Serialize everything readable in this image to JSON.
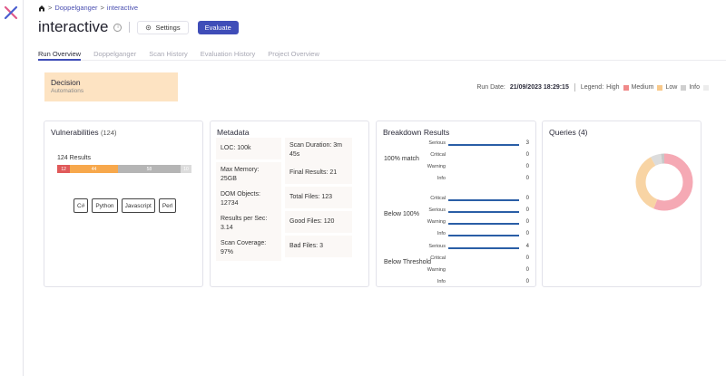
{
  "breadcrumb": {
    "items": [
      "Doppelganger",
      "interactive"
    ],
    "separator": ">"
  },
  "header": {
    "title": "interactive",
    "settings_label": "Settings",
    "evaluate_label": "Evaluate"
  },
  "tabs": [
    {
      "label": "Run Overview",
      "active": true
    },
    {
      "label": "Doppelganger",
      "active": false
    },
    {
      "label": "Scan History",
      "active": false
    },
    {
      "label": "Evaluation History",
      "active": false
    },
    {
      "label": "Project Overview",
      "active": false
    }
  ],
  "decision": {
    "title": "Decision",
    "subtitle": "Automations"
  },
  "run_info": {
    "run_date_label": "Run Date:",
    "run_date_value": "21/09/2023 18:29:15",
    "legend_label": "Legend:",
    "legend": [
      {
        "label": "High",
        "color": "#f08a8a"
      },
      {
        "label": "Medium",
        "color": "#f8c98a"
      },
      {
        "label": "Low",
        "color": "#cfcfcf"
      },
      {
        "label": "Info",
        "color": "#ececec"
      }
    ]
  },
  "vulnerabilities": {
    "title": "Vulnerabilities",
    "count": "(124)",
    "results_label": "124 Results",
    "segments": [
      {
        "label": "12",
        "value": 12,
        "color": "#e05a5a"
      },
      {
        "label": "44",
        "value": 44,
        "color": "#f7a84c"
      },
      {
        "label": "58",
        "value": 58,
        "color": "#b5b5b5"
      },
      {
        "label": "10",
        "value": 10,
        "color": "#dcdcdc"
      }
    ],
    "languages": [
      "C#",
      "Python",
      "Javascript",
      "Perl"
    ]
  },
  "metadata": {
    "title": "Metadata",
    "items": [
      "LOC: 100k",
      "Scan Duration: 3m 45s",
      "Max Memory: 25GB",
      "Final Results: 21",
      "DOM Objects: 12734",
      "Total Files: 123",
      "Results per Sec: 3.14",
      "Good Files: 120",
      "Scan Coverage: 97%",
      "Bad Files: 3"
    ]
  },
  "breakdown": {
    "title": "Breakdown Results",
    "groups": [
      {
        "label": "100% match",
        "rows": [
          {
            "label": "Serious",
            "value": 3,
            "level": 1
          },
          {
            "label": "Critical",
            "value": 0,
            "level": 0
          },
          {
            "label": "Warning",
            "value": 0,
            "level": 0
          },
          {
            "label": "Info",
            "value": 0,
            "level": 0
          }
        ]
      },
      {
        "label": "Below 100%",
        "rows": [
          {
            "label": "Critical",
            "value": 0,
            "level": 1
          },
          {
            "label": "Serious",
            "value": 0,
            "level": 1
          },
          {
            "label": "Warning",
            "value": 0,
            "level": 1
          },
          {
            "label": "Info",
            "value": 0,
            "level": 1
          }
        ]
      },
      {
        "label": "Below Threshold",
        "rows": [
          {
            "label": "Serious",
            "value": 4,
            "level": 1
          },
          {
            "label": "Critical",
            "value": 0,
            "level": 0
          },
          {
            "label": "Warning",
            "value": 0,
            "level": 0
          },
          {
            "label": "Info",
            "value": 0,
            "level": 0
          }
        ]
      }
    ],
    "bar_color": "#2a5ea6"
  },
  "queries": {
    "title": "Queries (4)",
    "donut": [
      {
        "value": 56,
        "color": "#f5a9b4"
      },
      {
        "value": 36,
        "color": "#f8d4a4"
      },
      {
        "value": 6,
        "color": "#dcdcdc"
      },
      {
        "value": 2,
        "color": "#c8c8c8"
      }
    ]
  }
}
